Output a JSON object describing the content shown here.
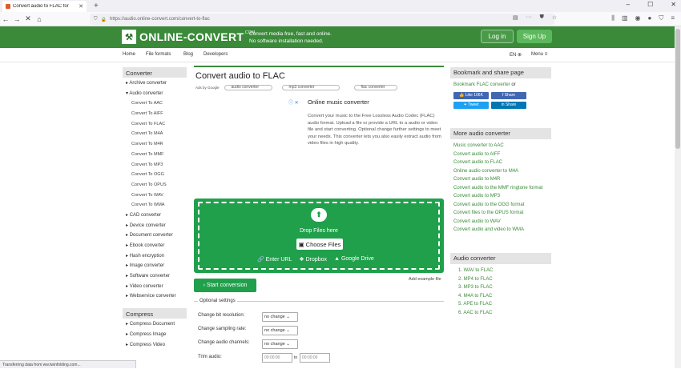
{
  "browser": {
    "tab_title": "Convert audio to FLAC for",
    "url": "https://audio.online-convert.com/convert-to-flac"
  },
  "site": {
    "logo_text": "ONLINE-CONVERT",
    "logo_suffix": ".COM",
    "tagline_1": "Convert media free, fast and online.",
    "tagline_2": "No software installation needed.",
    "login": "Log in",
    "signup": "Sign Up",
    "brand_color": "#3a8a3a"
  },
  "menu": {
    "home": "Home",
    "file_formats": "File formats",
    "blog": "Blog",
    "developers": "Developers",
    "lang": "EN",
    "menu": "Menu"
  },
  "sidebar": {
    "converter_head": "Converter",
    "items": [
      {
        "label": "Archive converter"
      },
      {
        "label": "Audio converter"
      }
    ],
    "audio_sub": [
      "Convert To AAC",
      "Convert To AIFF",
      "Convert To FLAC",
      "Convert To M4A",
      "Convert To M4R",
      "Convert To MMF",
      "Convert To MP3",
      "Convert To OGG",
      "Convert To OPUS",
      "Convert To WAV",
      "Convert To WMA"
    ],
    "more_items": [
      "CAD converter",
      "Device converter",
      "Document converter",
      "Ebook converter",
      "Hash encryption",
      "Image converter",
      "Software converter",
      "Video converter",
      "Webservice converter"
    ],
    "compress_head": "Compress",
    "compress_items": [
      "Compress Document",
      "Compress Image",
      "Compress Video"
    ]
  },
  "main": {
    "title": "Convert audio to FLAC",
    "ads_by_google": "Ads by Google",
    "search_pills": [
      "audio converter",
      "mp3 converter",
      "flac converter"
    ],
    "ad_title": "Online music converter",
    "ad_text": "Convert your music to the Free Lossless Audio Codec (FLAC) audio format. Upload a file or provide a URL to a audio or video file and start converting. Optional change further settings to meet your needs. This converter lets you also easily extract audio from video files in high quality.",
    "drop_files": "Drop Files here",
    "choose_files": "Choose Files",
    "enter_url": "Enter URL",
    "dropbox": "Dropbox",
    "google_drive": "Google Drive",
    "start_conversion": "Start conversion",
    "add_example": "Add example file",
    "optional_settings": "Optional settings",
    "settings": [
      {
        "label": "Change bit resolution:",
        "value": "no change"
      },
      {
        "label": "Change sampling rate:",
        "value": "no change"
      },
      {
        "label": "Change audio channels:",
        "value": "no change"
      }
    ],
    "trim_label": "Trim audio:",
    "trim_from": "00:00:00",
    "trim_to_word": "to",
    "trim_to": "00:00:00"
  },
  "right": {
    "bookmark_head": "Bookmark and share page",
    "bookmark_text": "Bookmark FLAC converter",
    "bookmark_or": "or",
    "like": "Like 106K",
    "share_fb": "Share",
    "tweet": "Tweet",
    "share_in": "Share",
    "more_head": "More audio converter",
    "more_links": [
      "Music converter to AAC",
      "Convert audio to AIFF",
      "Convert audio to FLAC",
      "Online audio converter to M4A",
      "Convert audio to M4R",
      "Convert audio to the MMF ringtone format",
      "Convert audio to MP3",
      "Convert audio to the OGG format",
      "Convert files to the OPUS format",
      "Convert audio to WAV",
      "Convert audio and video to WMA"
    ],
    "audio_head": "Audio converter",
    "audio_list": [
      "1. WAV to FLAC",
      "2. MP4 to FLAC",
      "3. MP3 to FLAC",
      "4. M4A to FLAC",
      "5. APE to FLAC",
      "6. AAC to FLAC"
    ]
  },
  "status": "Transferring data from ww.twinfolding.com..."
}
